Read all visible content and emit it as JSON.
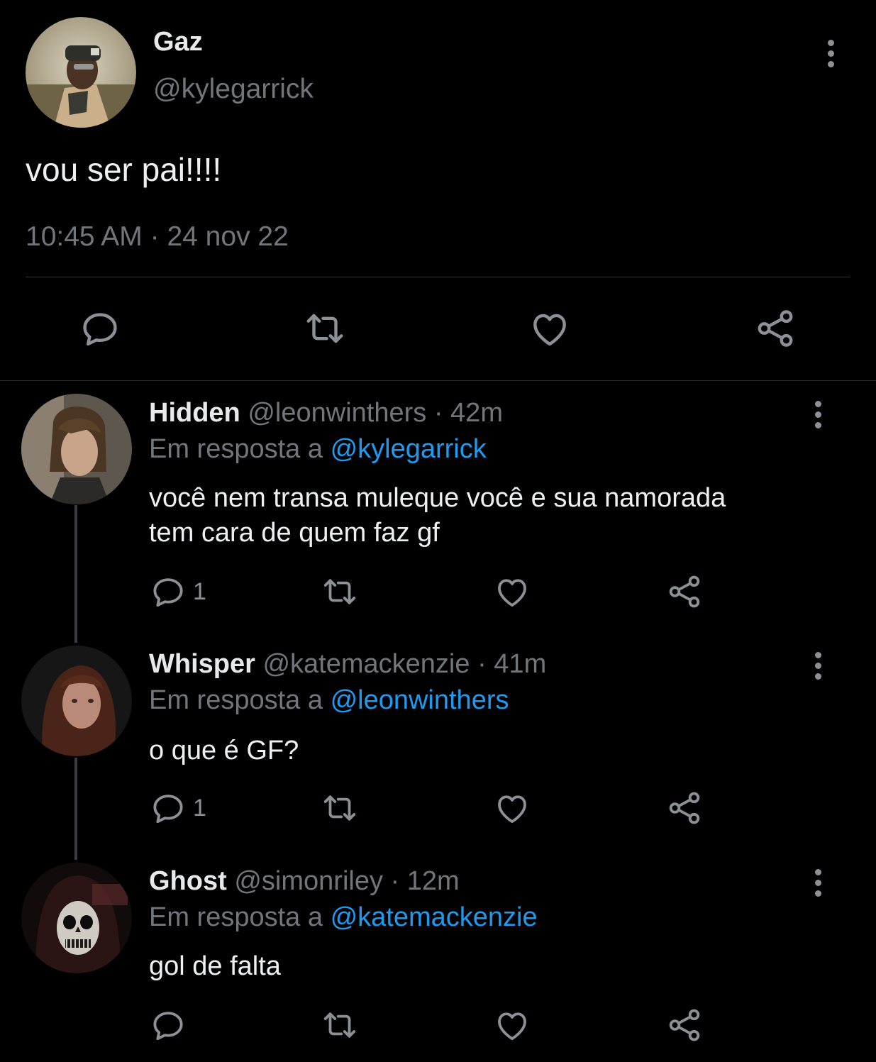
{
  "main_tweet": {
    "name": "Gaz",
    "handle": "@kylegarrick",
    "text": "vou ser pai!!!!",
    "time": "10:45 AM",
    "sep": "·",
    "date": "24 nov 22"
  },
  "replies": [
    {
      "name": "Hidden",
      "handle": "@leonwinthers",
      "sep": "·",
      "age": "42m",
      "reply_prefix": "Em resposta a",
      "reply_to": "@kylegarrick",
      "text_line1": "você nem transa muleque você e sua namorada",
      "text_line2": "tem cara de quem faz gf",
      "reply_count": "1"
    },
    {
      "name": "Whisper",
      "handle": "@katemackenzie",
      "sep": "·",
      "age": "41m",
      "reply_prefix": "Em resposta a",
      "reply_to": "@leonwinthers",
      "text_line1": "o que é GF?",
      "reply_count": "1"
    },
    {
      "name": "Ghost",
      "handle": "@simonriley",
      "sep": "·",
      "age": "12m",
      "reply_prefix": "Em resposta a",
      "reply_to": "@katemackenzie",
      "text_line1": "gol de falta",
      "reply_count": ""
    }
  ],
  "icons": [
    "more-icon",
    "reply-icon",
    "retweet-icon",
    "like-icon",
    "share-icon"
  ],
  "colors": {
    "background": "#000000",
    "text": "#e7e9ea",
    "muted": "#71767b",
    "link": "#1d9bf0",
    "icon": "#8b9196"
  }
}
